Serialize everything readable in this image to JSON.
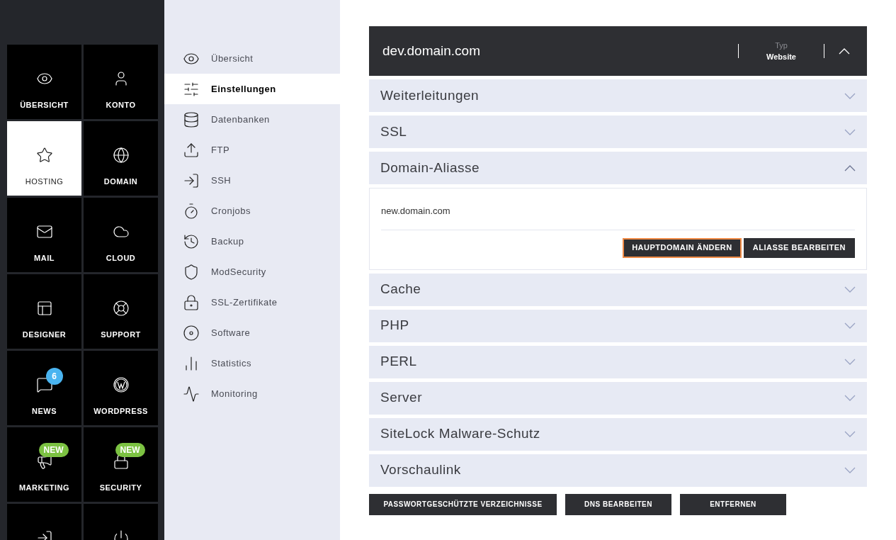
{
  "tiles": [
    {
      "label": "ÜBERSICHT",
      "selected": false
    },
    {
      "label": "KONTO",
      "selected": false
    },
    {
      "label": "HOSTING",
      "selected": true
    },
    {
      "label": "DOMAIN",
      "selected": false
    },
    {
      "label": "MAIL",
      "selected": false
    },
    {
      "label": "CLOUD",
      "selected": false
    },
    {
      "label": "DESIGNER",
      "selected": false
    },
    {
      "label": "SUPPORT",
      "selected": false
    },
    {
      "label": "NEWS",
      "selected": false,
      "badge": {
        "kind": "count",
        "text": "6"
      }
    },
    {
      "label": "WORDPRESS",
      "selected": false
    },
    {
      "label": "MARKETING",
      "selected": false,
      "badge": {
        "kind": "new",
        "text": "NEW"
      }
    },
    {
      "label": "SECURITY",
      "selected": false,
      "badge": {
        "kind": "new",
        "text": "NEW"
      }
    },
    {
      "selected": false
    },
    {
      "selected": false
    }
  ],
  "subnav": [
    {
      "label": "Übersicht",
      "selected": false
    },
    {
      "label": "Einstellungen",
      "selected": true
    },
    {
      "label": "Datenbanken",
      "selected": false
    },
    {
      "label": "FTP",
      "selected": false
    },
    {
      "label": "SSH",
      "selected": false
    },
    {
      "label": "Cronjobs",
      "selected": false
    },
    {
      "label": "Backup",
      "selected": false
    },
    {
      "label": "ModSecurity",
      "selected": false
    },
    {
      "label": "SSL-Zertifikate",
      "selected": false
    },
    {
      "label": "Software",
      "selected": false
    },
    {
      "label": "Statistics",
      "selected": false
    },
    {
      "label": "Monitoring",
      "selected": false
    }
  ],
  "domain": {
    "title": "dev.domain.com",
    "type_label": "Typ",
    "type_value": "Website",
    "expanded": true
  },
  "sections": [
    {
      "title": "Weiterleitungen",
      "expanded": false
    },
    {
      "title": "SSL",
      "expanded": false
    },
    {
      "title": "Domain-Aliasse",
      "expanded": true,
      "content": {
        "alias": "new.domain.com",
        "buttons": [
          {
            "label": "HAUPTDOMAIN ÄNDERN",
            "focused": true
          },
          {
            "label": "ALIASSE BEARBEITEN",
            "focused": false
          }
        ]
      }
    },
    {
      "title": "Cache",
      "expanded": false
    },
    {
      "title": "PHP",
      "expanded": false
    },
    {
      "title": "PERL",
      "expanded": false
    },
    {
      "title": "Server",
      "expanded": false
    },
    {
      "title": "SiteLock Malware-Schutz",
      "expanded": false
    },
    {
      "title": "Vorschaulink",
      "expanded": false
    }
  ],
  "actions": [
    "PASSWORTGESCHÜTZTE VERZEICHNISSE",
    "DNS BEARBEITEN",
    "ENTFERNEN"
  ]
}
